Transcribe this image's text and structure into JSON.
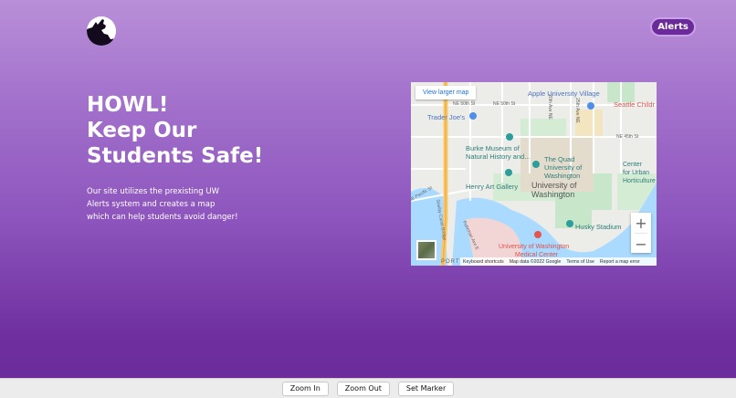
{
  "header": {
    "logo_icon": "wolf-howling-icon",
    "alerts_label": "Alerts"
  },
  "hero": {
    "title_lines": [
      "HOWL!",
      "Keep Our",
      "Students Safe!"
    ],
    "description_lines": [
      "Our site utilizes the prexisting UW",
      "Alerts system and creates a map",
      "which can help students avoid danger!"
    ]
  },
  "map": {
    "view_larger_label": "View larger map",
    "places": {
      "apple_village": "Apple University Village",
      "seattle_children": "Seattle Childr",
      "trader_joes": "Trader Joe's",
      "burke_1": "Burke Museum of",
      "burke_2": "Natural History and...",
      "quad_1": "The Quad",
      "quad_2": "University of",
      "quad_3": "Washington",
      "uw_1": "University of",
      "uw_2": "Washington",
      "center_1": "Center",
      "center_2": "for Urban",
      "center_3": "Horticulture",
      "henry": "Henry Art Gallery",
      "husky": "Husky Stadium",
      "uwmc_1": "University of Washington",
      "uwmc_2": "Medical Center",
      "port": "PORT"
    },
    "streets": {
      "ne50_a": "NE 50th St",
      "ne50_b": "NE 50th St",
      "ne45": "NE 45th St",
      "ave20": "20th Ave NE",
      "ave25": "25th Ave NE",
      "pacific": "NE Pacific St",
      "montlake": "Shelby Canal Bridge",
      "ave_e": "Fuhrman Ave E"
    },
    "zoom_in_symbol": "+",
    "zoom_out_symbol": "−",
    "footer": {
      "shortcuts": "Keyboard shortcuts",
      "map_data": "Map data ©2022 Google",
      "terms": "Terms of Use",
      "report": "Report a map error"
    }
  },
  "toolbar": {
    "zoom_in_label": "Zoom In",
    "zoom_out_label": "Zoom Out",
    "set_marker_label": "Set Marker"
  },
  "colors": {
    "brand_purple": "#6b2a99",
    "map_water": "#aadaff",
    "map_park": "#c8e6c9",
    "map_highway": "#f8c86a"
  }
}
